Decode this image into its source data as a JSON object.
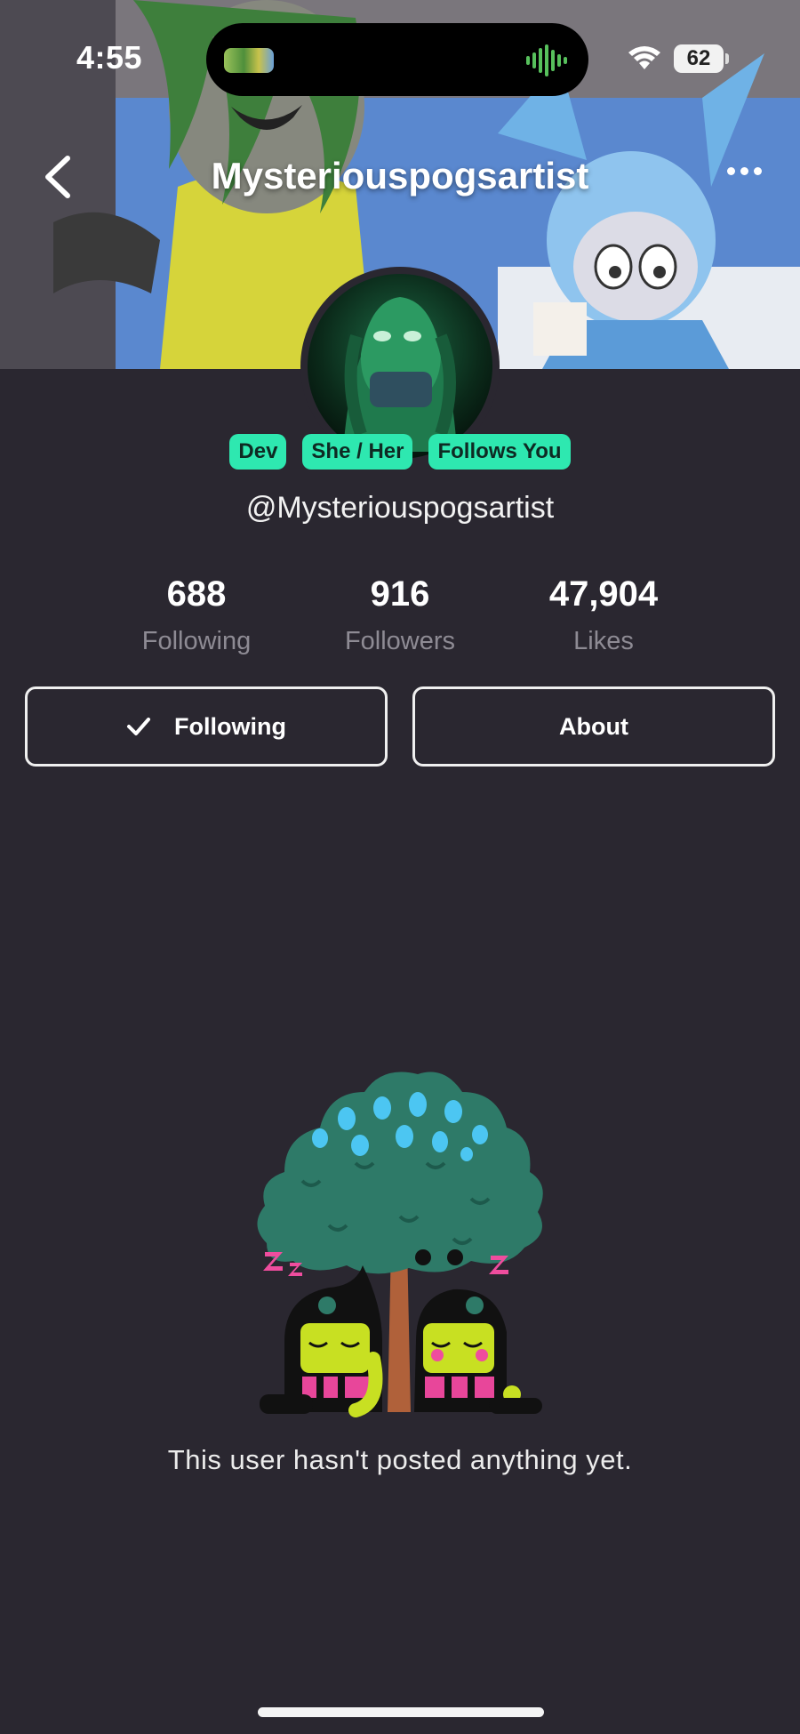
{
  "status_bar": {
    "time": "4:55",
    "battery": "62"
  },
  "header": {
    "title": "Mysteriouspogsartist"
  },
  "profile": {
    "badges": [
      "Dev",
      "She / Her",
      "Follows You"
    ],
    "handle": "@Mysteriouspogsartist"
  },
  "stats": [
    {
      "value": "688",
      "label": "Following"
    },
    {
      "value": "916",
      "label": "Followers"
    },
    {
      "value": "47,904",
      "label": "Likes"
    }
  ],
  "actions": {
    "following_label": "Following",
    "about_label": "About"
  },
  "empty_state": {
    "message": "This user hasn't posted anything yet."
  },
  "colors": {
    "accent": "#2ee8b0",
    "background": "#2a2730"
  }
}
